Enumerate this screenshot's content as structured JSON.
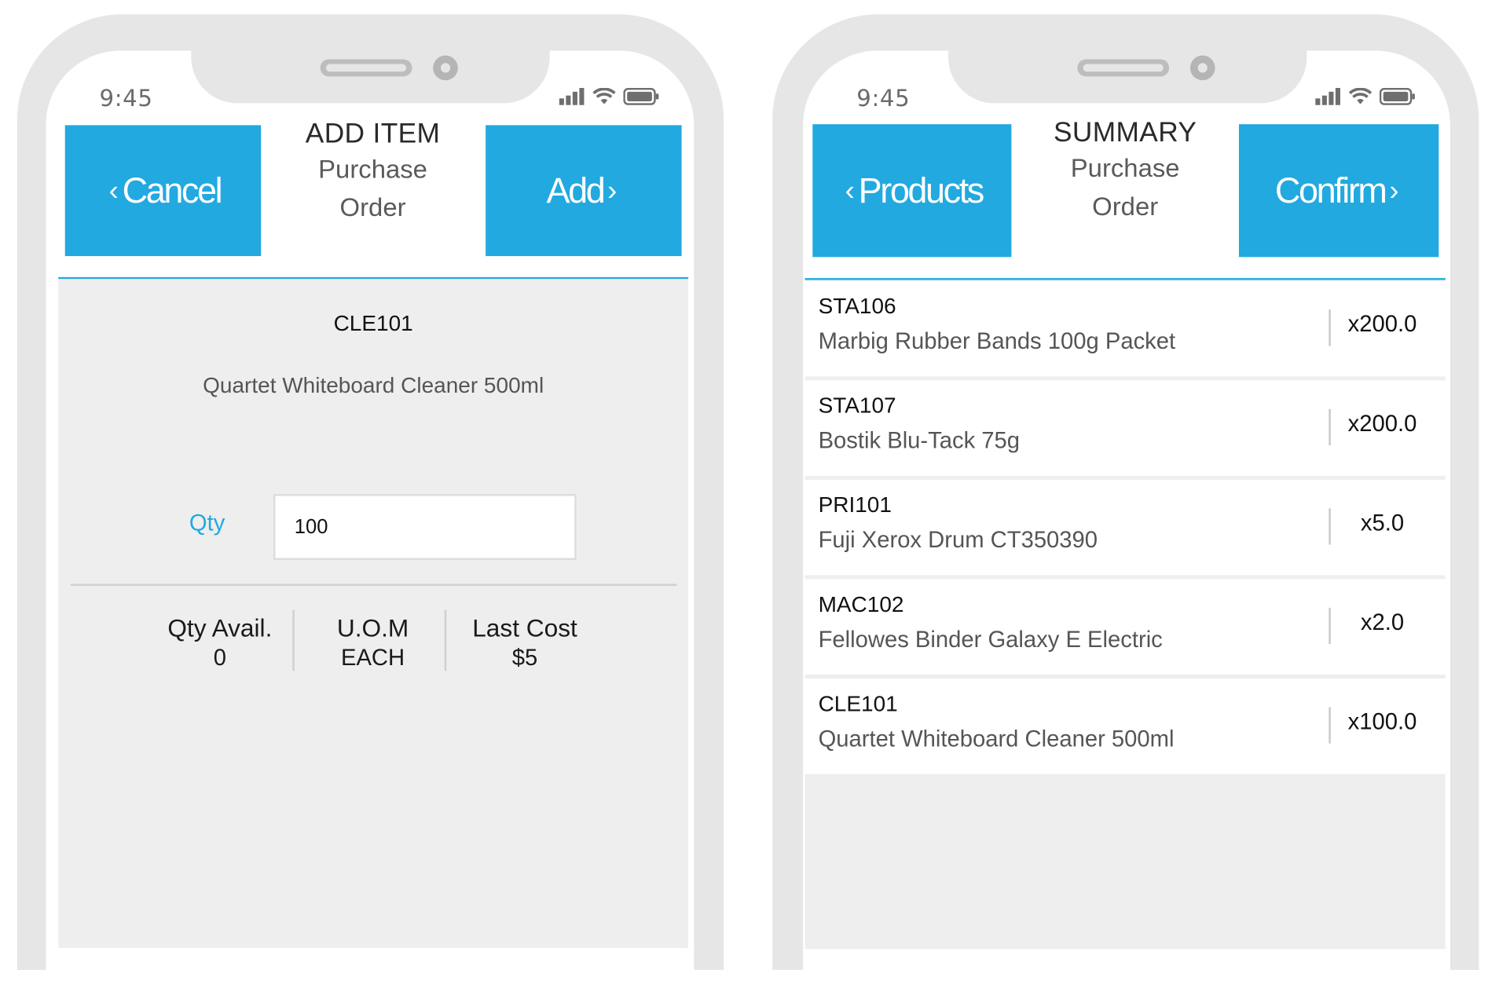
{
  "status_bar": {
    "time": "9:45",
    "icons": [
      "signal-icon",
      "wifi-icon",
      "battery-icon"
    ]
  },
  "colors": {
    "accent": "#22a9e0",
    "frame": "#e6e6e6",
    "panel": "#eeeeee"
  },
  "add_item_screen": {
    "header": {
      "title": "ADD ITEM",
      "subtitle_line1": "Purchase",
      "subtitle_line2": "Order",
      "left_button": {
        "chevron": "‹",
        "label": "Cancel"
      },
      "right_button": {
        "chevron": "›",
        "label": "Add"
      }
    },
    "product": {
      "code": "CLE101",
      "description": "Quartet Whiteboard Cleaner 500ml"
    },
    "qty": {
      "label": "Qty",
      "value": "100"
    },
    "stats": [
      {
        "label": "Qty Avail.",
        "value": "0"
      },
      {
        "label": "U.O.M",
        "value": "EACH"
      },
      {
        "label": "Last Cost",
        "value": "$5"
      }
    ]
  },
  "summary_screen": {
    "header": {
      "title": "SUMMARY",
      "subtitle_line1": "Purchase",
      "subtitle_line2": "Order",
      "left_button": {
        "chevron": "‹",
        "label": "Products"
      },
      "right_button": {
        "chevron": "›",
        "label": "Confirm"
      }
    },
    "items": [
      {
        "code": "STA106",
        "name": "Marbig Rubber Bands 100g Packet",
        "qty": "x200.0"
      },
      {
        "code": "STA107",
        "name": "Bostik Blu-Tack 75g",
        "qty": "x200.0"
      },
      {
        "code": "PRI101",
        "name": "Fuji Xerox Drum CT350390",
        "qty": "x5.0"
      },
      {
        "code": "MAC102",
        "name": "Fellowes Binder Galaxy E Electric",
        "qty": "x2.0"
      },
      {
        "code": "CLE101",
        "name": "Quartet Whiteboard Cleaner 500ml",
        "qty": "x100.0"
      }
    ]
  }
}
